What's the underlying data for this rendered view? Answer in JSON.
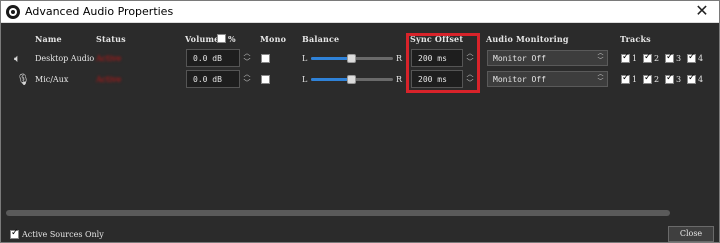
{
  "window": {
    "title": "Advanced Audio Properties",
    "close_glyph": "✕"
  },
  "headers": {
    "name": "Name",
    "status": "Status",
    "volume": "Volume",
    "volume_unit": "%",
    "mono": "Mono",
    "balance": "Balance",
    "sync_offset": "Sync Offset",
    "audio_monitoring": "Audio Monitoring",
    "tracks": "Tracks"
  },
  "rows": [
    {
      "icon": "speaker-icon",
      "name": "Desktop Audio",
      "status": "Active",
      "volume": "0.0 dB",
      "mono": false,
      "balance_left": "L",
      "balance_right": "R",
      "balance_level": 0.5,
      "sync_offset": "200 ms",
      "monitoring": "Monitor Off",
      "tracks": [
        "1",
        "2",
        "3",
        "4"
      ]
    },
    {
      "icon": "microphone-icon",
      "name": "Mic/Aux",
      "status": "Active",
      "volume": "0.0 dB",
      "mono": false,
      "balance_left": "L",
      "balance_right": "R",
      "balance_level": 0.5,
      "sync_offset": "200 ms",
      "monitoring": "Monitor Off",
      "tracks": [
        "1",
        "2",
        "3",
        "4"
      ]
    }
  ],
  "footer": {
    "active_only_label": "Active Sources Only",
    "active_only_checked": true,
    "close_label": "Close"
  },
  "colors": {
    "highlight": "#d8232a",
    "status": "#c81414",
    "accent": "#2f82d8"
  }
}
